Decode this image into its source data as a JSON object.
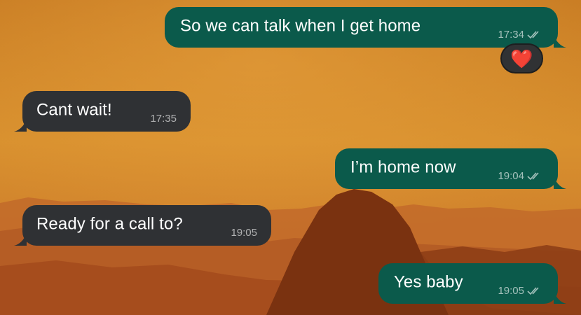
{
  "colors": {
    "outgoing_bubble": "#0b5a4b",
    "incoming_bubble": "#2f3134",
    "wallpaper_sky": "#d48a2a",
    "wallpaper_mountains": "#8a3a12"
  },
  "messages": [
    {
      "direction": "outgoing",
      "text": "So we can talk when I get home",
      "time": "17:34",
      "status": "read-double-check-icon"
    },
    {
      "direction": "outgoing",
      "reaction": "❤️"
    },
    {
      "direction": "incoming",
      "text": "Cant wait!",
      "time": "17:35"
    },
    {
      "direction": "outgoing",
      "text": "I’m home now",
      "time": "19:04",
      "status": "read-double-check-icon"
    },
    {
      "direction": "incoming",
      "text": "Ready for a call to?",
      "time": "19:05"
    },
    {
      "direction": "outgoing",
      "text": "Yes baby",
      "time": "19:05",
      "status": "read-double-check-icon"
    }
  ]
}
